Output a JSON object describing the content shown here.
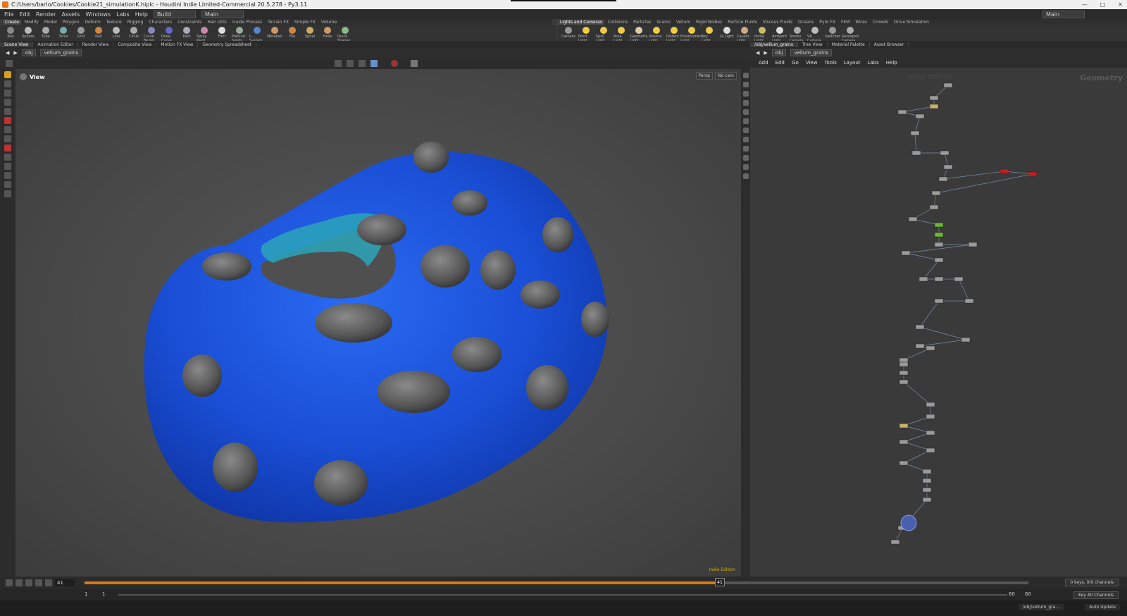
{
  "window": {
    "title": "C:/Users/barlo/Cookies/Cookie21_simulationK.hiplc - Houdini Indie Limited-Commercial 20.5.278 - Py3.11",
    "desktop_right": "Main"
  },
  "menubar": {
    "items": [
      "File",
      "Edit",
      "Render",
      "Assets",
      "Windows",
      "Labs",
      "Help"
    ],
    "desktop": "Build",
    "context": "Main"
  },
  "shelf_left": {
    "tabs": [
      "Create",
      "Modify",
      "Model",
      "Polygon",
      "Deform",
      "Texture",
      "Rigging",
      "Characters",
      "Constraints",
      "Hair Utils",
      "Guide Process",
      "Terrain FX",
      "Simple FX",
      "Volume"
    ],
    "tools": [
      "Box",
      "Sphere",
      "Tube",
      "Torus",
      "Grid",
      "Null",
      "Line",
      "Circle",
      "Curve Bezier",
      "Draw Curve",
      "Path",
      "Spray Paint",
      "Font",
      "Platonic Solids",
      "L-System",
      "Metaball",
      "File",
      "Spiral",
      "Helix",
      "Quick Shapes"
    ]
  },
  "shelf_right": {
    "tabs": [
      "Lights and Cameras",
      "Collisions",
      "Particles",
      "Grains",
      "Vellum",
      "Rigid Bodies",
      "Particle Fluids",
      "Viscous Fluids",
      "Oceans",
      "Pyro FX",
      "FEM",
      "Wires",
      "Crowds",
      "Drive Simulation"
    ],
    "tools": [
      "Camera",
      "Point Light",
      "Spot Light",
      "Area Light",
      "Geometry Light",
      "Volume Light",
      "Distant Light",
      "Environment Light",
      "Sky Light",
      "GI Light",
      "Caustic Light",
      "Portal Light",
      "Ambient Light",
      "Stereo Camera",
      "VR Camera",
      "Switcher",
      "Gamepad Camera"
    ]
  },
  "left_pane": {
    "tabs": [
      "Scene View",
      "Animation Editor",
      "Render View",
      "Composite View",
      "Motion FX View",
      "Geometry Spreadsheet"
    ],
    "path_root": "obj",
    "path_node": "vellum_grains",
    "viewport_label": "View",
    "persp": "Persp",
    "camera": "No cam",
    "watermark": "Indie Edition"
  },
  "right_pane": {
    "tabs": [
      "/obj/vellum_grains",
      "Tree View",
      "Material Palette",
      "Asset Browser"
    ],
    "path_root": "obj",
    "path_node": "vellum_grains",
    "menu": [
      "Add",
      "Edit",
      "Go",
      "View",
      "Tools",
      "Layout",
      "Labs",
      "Help"
    ],
    "watermark": "Indie Edition",
    "context": "Geometry"
  },
  "timeline": {
    "current_frame": "41",
    "marker": "41",
    "progress_fraction": 0.67,
    "keys_label": "0 keys, 0/0 channels",
    "key_all": "Key All Channels",
    "start": "1",
    "start2": "1",
    "end1": "60",
    "end2": "60"
  },
  "status": {
    "path": "/obj/vellum_gra...",
    "auto_update": "Auto Update"
  },
  "colors": {
    "cookie_blue": "#1a4fd6",
    "chip_gray": "#555555",
    "timeline_orange": "#d87a16"
  }
}
